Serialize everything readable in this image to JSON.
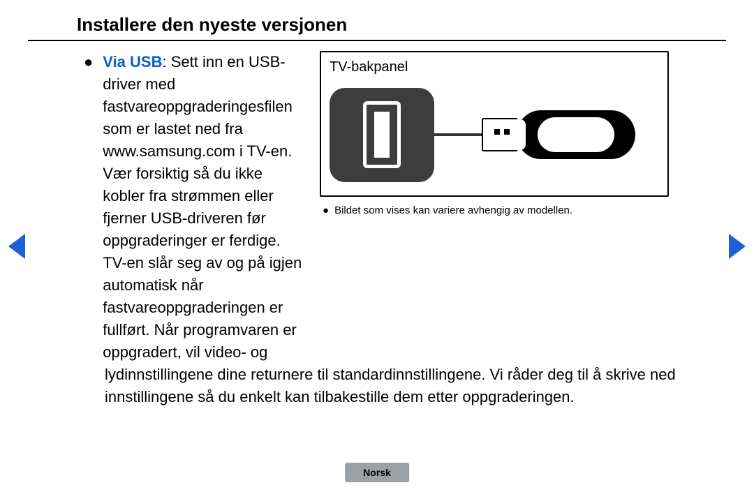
{
  "title": "Installere den nyeste versjonen",
  "bullet_highlight": "Via USB",
  "body_part1": ": Sett inn en USB-driver med fastvareoppgraderingesfilen som er lastet ned fra www.samsung.com i TV-en. Vær forsiktig så du ikke kobler fra strømmen eller fjerner USB-driveren før oppgraderinger er ferdige. TV-en slår seg av og på igjen automatisk når fastvareoppgraderingen er fullført. Når programvaren er oppgradert, vil video- og",
  "body_part2": "lydinnstillingene dine returnere til standardinnstillingene. Vi råder deg til å skrive ned innstillingene så du enkelt kan tilbakestille dem etter oppgraderingen.",
  "figure_label": "TV-bakpanel",
  "figure_caption": "Bildet som vises kan variere avhengig av modellen.",
  "language": "Norsk"
}
